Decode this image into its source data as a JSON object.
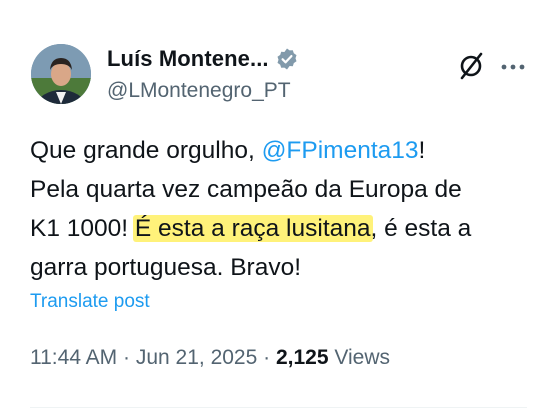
{
  "author": {
    "display_name": "Luís Montene...",
    "handle": "@LMontenegro_PT",
    "verified": true
  },
  "icons": {
    "avatar": "profile-photo",
    "verified": "verified-badge-icon",
    "grok": "grok-icon",
    "more": "more-options-icon"
  },
  "post": {
    "line1_prefix": "Que grande orgulho, ",
    "mention": "@FPimenta13",
    "line1_suffix": "!",
    "line2": "Pela quarta vez campeão da Europa de",
    "line3_prefix": "K1 1000! ",
    "highlight": "É esta a raça lusitana",
    "line3_suffix": ", é esta a",
    "line4": "garra portuguesa. Bravo!"
  },
  "translate_label": "Translate post",
  "meta": {
    "time": "11:44 AM",
    "separator1": " · ",
    "date": "Jun 21, 2025",
    "separator2": " · ",
    "views_count": "2,125",
    "views_label": " Views"
  },
  "colors": {
    "link": "#1d9bf0",
    "muted": "#536471",
    "text": "#0f1419",
    "highlight": "#fff27a"
  }
}
